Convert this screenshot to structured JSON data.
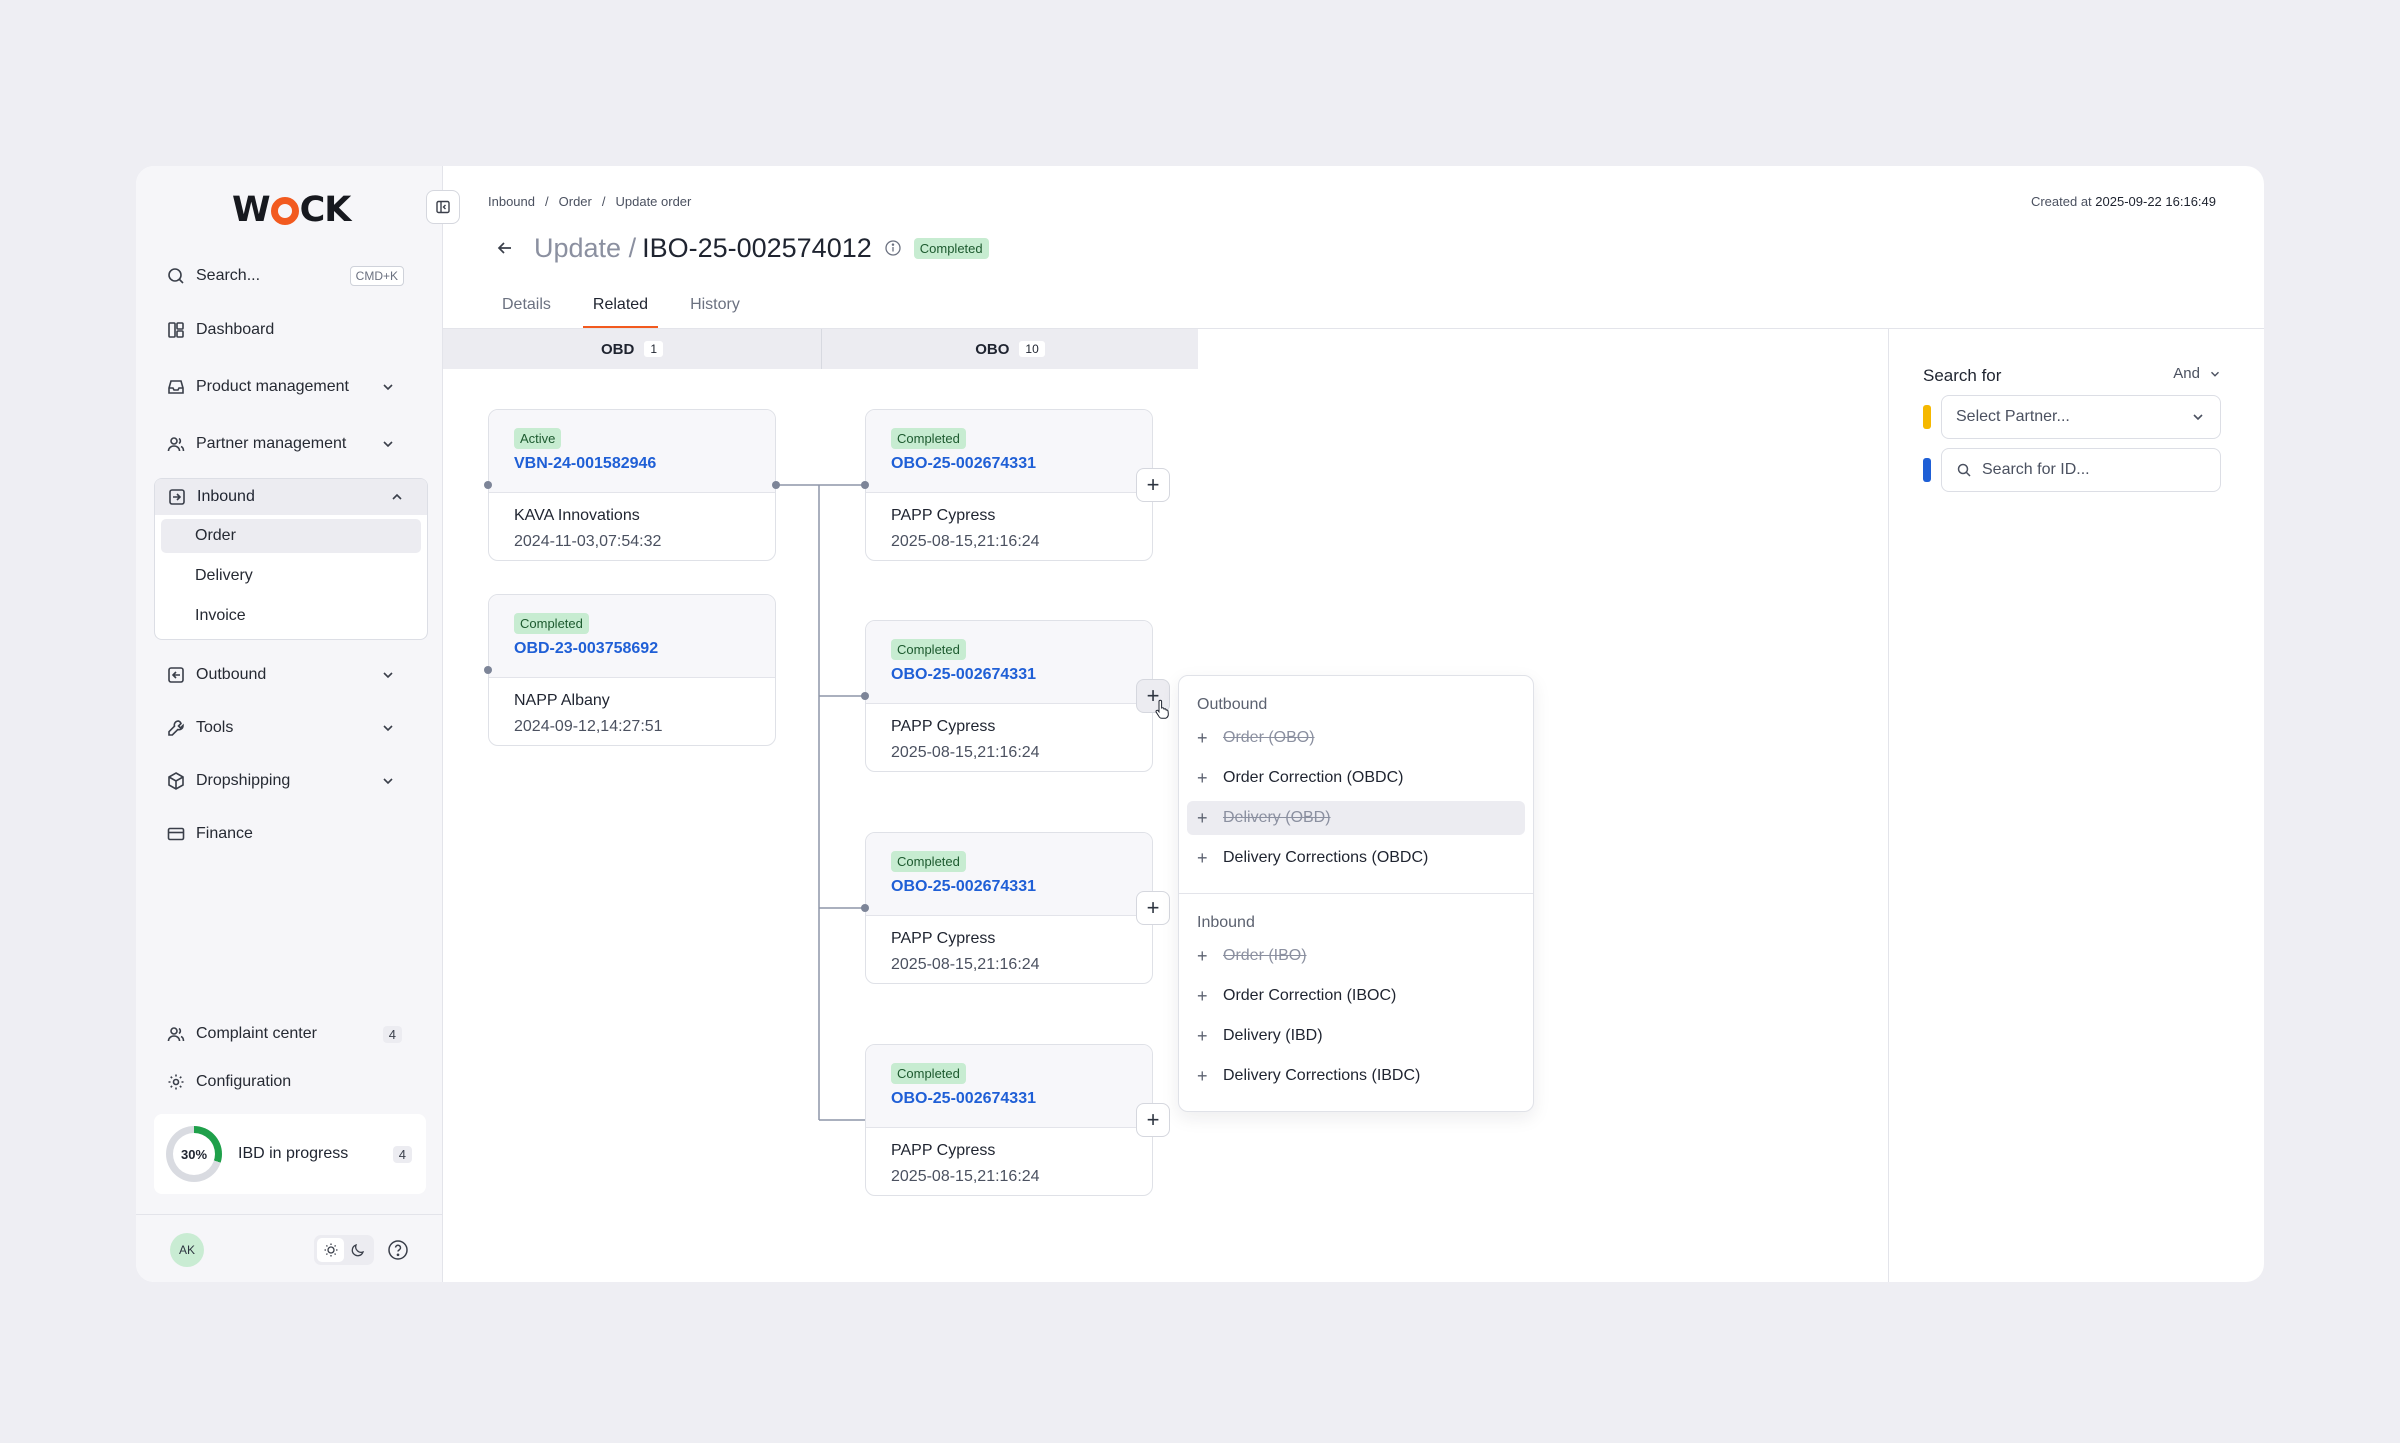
{
  "app": {
    "logo": "WOCK"
  },
  "sidebar": {
    "search_label": "Search...",
    "search_shortcut": "CMD+K",
    "items": {
      "dashboard": "Dashboard",
      "product_management": "Product management",
      "partner_management": "Partner management",
      "inbound": "Inbound",
      "outbound": "Outbound",
      "tools": "Tools",
      "dropshipping": "Dropshipping",
      "finance": "Finance",
      "complaint_center": "Complaint center",
      "configuration": "Configuration"
    },
    "inbound_sub": {
      "order": "Order",
      "delivery": "Delivery",
      "invoice": "Invoice"
    },
    "complaint_count": "4",
    "progress": {
      "percent_label": "30%",
      "value": 0.3,
      "label": "IBD in progress",
      "count": "4",
      "color": "#1fa04a"
    },
    "user_initials": "AK"
  },
  "header": {
    "breadcrumb": [
      "Inbound",
      "/",
      "Order",
      "/",
      "Update order"
    ],
    "created_label": "Created at",
    "created_value": "2025-09-22 16:16:49",
    "title_prefix": "Update /",
    "title_id": "IBO-25-002574012",
    "status": "Completed"
  },
  "tabs": {
    "details": "Details",
    "related": "Related",
    "history": "History"
  },
  "columns": {
    "obd": {
      "label": "OBD",
      "count": "1"
    },
    "obo": {
      "label": "OBO",
      "count": "10"
    }
  },
  "obd_cards": [
    {
      "status": "Active",
      "id": "VBN-24-001582946",
      "name": "KAVA Innovations",
      "date": "2024-11-03,07:54:32"
    },
    {
      "status": "Completed",
      "id": "OBD-23-003758692",
      "name": "NAPP Albany",
      "date": "2024-09-12,14:27:51"
    }
  ],
  "obo_cards": [
    {
      "status": "Completed",
      "id": "OBO-25-002674331",
      "name": "PAPP Cypress",
      "date": "2025-08-15,21:16:24"
    },
    {
      "status": "Completed",
      "id": "OBO-25-002674331",
      "name": "PAPP Cypress",
      "date": "2025-08-15,21:16:24"
    },
    {
      "status": "Completed",
      "id": "OBO-25-002674331",
      "name": "PAPP Cypress",
      "date": "2025-08-15,21:16:24"
    },
    {
      "status": "Completed",
      "id": "OBO-25-002674331",
      "name": "PAPP Cypress",
      "date": "2025-08-15,21:16:24"
    }
  ],
  "dropdown": {
    "outbound_label": "Outbound",
    "outbound_items": [
      "Order (OBO)",
      "Order Correction (OBDC)",
      "Delivery (OBD)",
      "Delivery Corrections (OBDC)"
    ],
    "inbound_label": "Inbound",
    "inbound_items": [
      "Order (IBO)",
      "Order Correction (IBOC)",
      "Delivery (IBD)",
      "Delivery Corrections (IBDC)"
    ]
  },
  "filter_panel": {
    "title": "Search for",
    "operator": "And",
    "partner_placeholder": "Select Partner...",
    "id_placeholder": "Search for ID...",
    "colors": {
      "partner": "#f5b800",
      "id": "#1f5fd6"
    }
  },
  "colors": {
    "accent": "#f25a1f",
    "link": "#1f5fd6",
    "status_green_bg": "#c7ecd1"
  }
}
